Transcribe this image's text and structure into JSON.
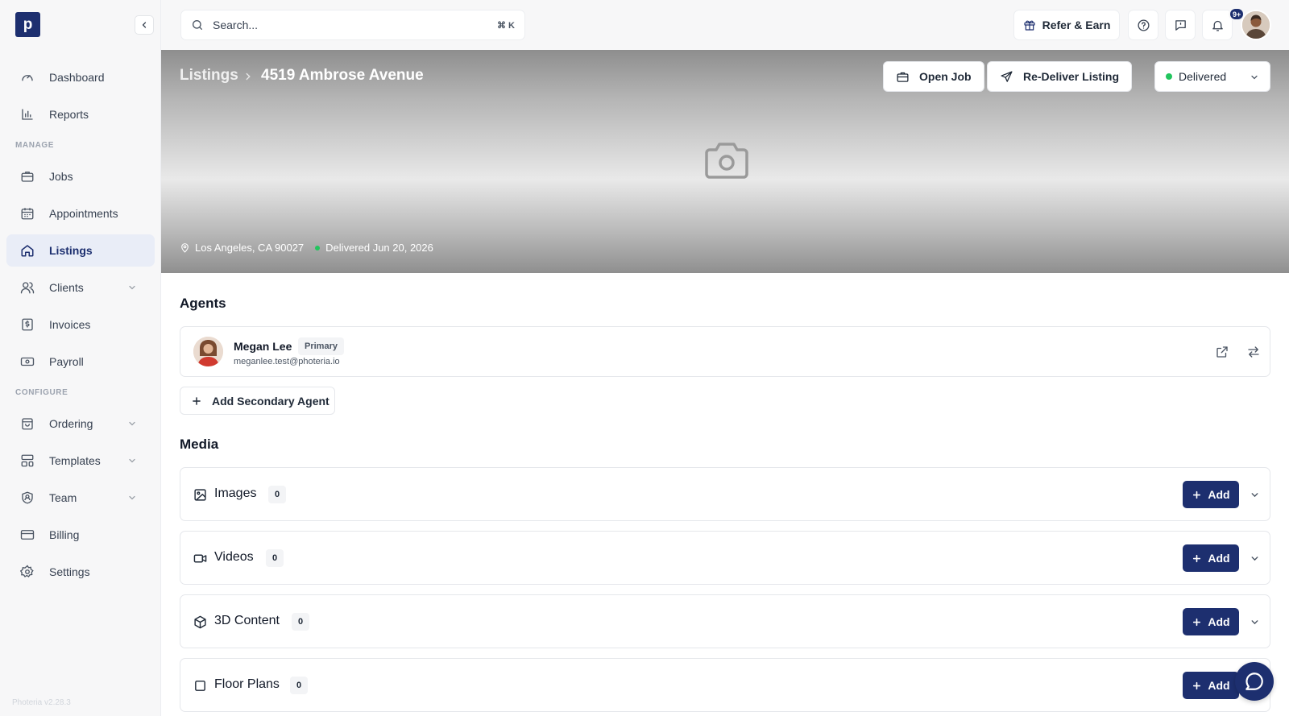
{
  "app": {
    "logo_letter": "p",
    "version": "Photeria v2.28.3"
  },
  "sidebar": {
    "items": [
      {
        "label": "Dashboard",
        "icon": "gauge-icon"
      },
      {
        "label": "Reports",
        "icon": "bar-chart-icon"
      },
      {
        "label": "Jobs",
        "icon": "briefcase-icon"
      },
      {
        "label": "Appointments",
        "icon": "calendar-icon"
      },
      {
        "label": "Listings",
        "icon": "home-icon",
        "active": true
      },
      {
        "label": "Clients",
        "icon": "users-icon",
        "expandable": true
      },
      {
        "label": "Invoices",
        "icon": "dollar-doc-icon"
      },
      {
        "label": "Payroll",
        "icon": "banknote-icon"
      },
      {
        "label": "Ordering",
        "icon": "shopping-bag-icon",
        "expandable": true
      },
      {
        "label": "Templates",
        "icon": "layout-icon",
        "expandable": true
      },
      {
        "label": "Team",
        "icon": "shield-user-icon",
        "expandable": true
      },
      {
        "label": "Billing",
        "icon": "credit-card-icon"
      },
      {
        "label": "Settings",
        "icon": "gear-icon"
      }
    ],
    "sections": {
      "manage": "MANAGE",
      "configure": "CONFIGURE"
    }
  },
  "topbar": {
    "search_placeholder": "Search...",
    "search_shortcut": "⌘ K",
    "refer_label": "Refer & Earn",
    "notification_count": "9+"
  },
  "hero": {
    "breadcrumb_parent": "Listings",
    "title": "4519 Ambrose Avenue",
    "open_job_label": "Open Job",
    "redeliver_label": "Re-Deliver Listing",
    "status": "Delivered",
    "status_color": "#22c55e",
    "location": "Los Angeles, CA 90027",
    "delivered_text": "Delivered Jun 20, 2026"
  },
  "agents": {
    "title": "Agents",
    "primary": {
      "name": "Megan Lee",
      "badge": "Primary",
      "email": "meganlee.test@photeria.io"
    },
    "add_secondary_label": "Add Secondary Agent"
  },
  "media": {
    "title": "Media",
    "add_label": "Add",
    "rows": [
      {
        "label": "Images",
        "count": "0",
        "icon": "image-icon"
      },
      {
        "label": "Videos",
        "count": "0",
        "icon": "video-icon"
      },
      {
        "label": "3D Content",
        "count": "0",
        "icon": "cube-icon"
      },
      {
        "label": "Floor Plans",
        "count": "0",
        "icon": "square-icon"
      }
    ]
  },
  "colors": {
    "brand": "#1d2f6f",
    "active_bg": "#e9edf7"
  }
}
